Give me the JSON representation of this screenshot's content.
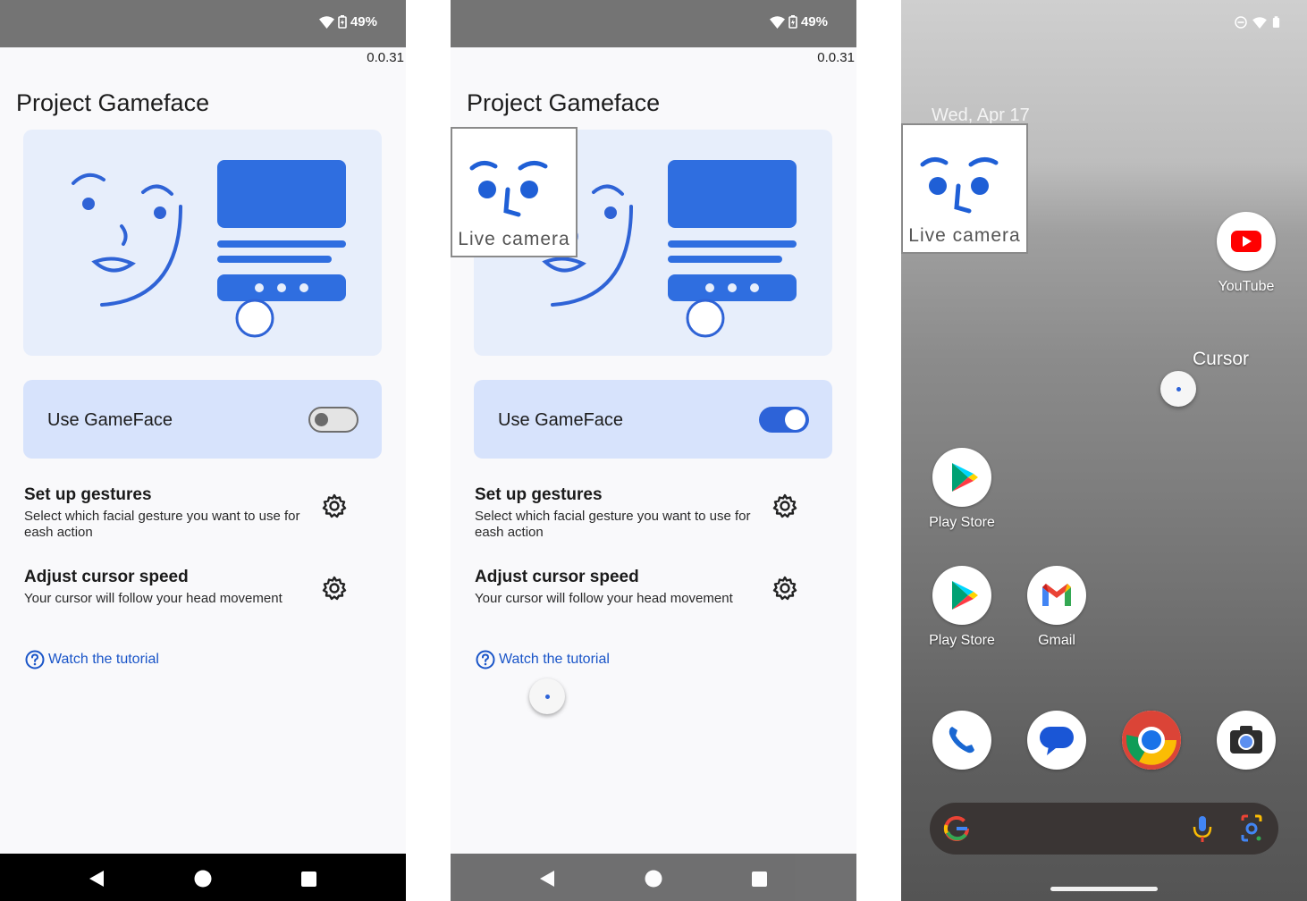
{
  "status": {
    "battery": "49%"
  },
  "app": {
    "version": "0.0.31",
    "title": "Project Gameface",
    "toggle_label": "Use GameFace",
    "settings": [
      {
        "title": "Set up gestures",
        "desc": "Select which facial gesture you want to use for eash action"
      },
      {
        "title": "Adjust cursor speed",
        "desc": "Your cursor will follow your head movement"
      }
    ],
    "tutorial": "Watch the tutorial",
    "live_camera": "Live camera"
  },
  "screens": [
    {
      "toggle_state": "off"
    },
    {
      "toggle_state": "on"
    },
    {
      "name": "home"
    }
  ],
  "home": {
    "date": "Wed, Apr 17",
    "cursor_label": "Cursor",
    "apps": [
      {
        "label": "YouTube",
        "icon": "youtube-icon"
      },
      {
        "label": "Play Store",
        "icon": "play-store-icon"
      },
      {
        "label": "Play Store",
        "icon": "play-store-icon"
      },
      {
        "label": "Gmail",
        "icon": "gmail-icon"
      }
    ],
    "dock": [
      "phone-icon",
      "messages-icon",
      "chrome-icon",
      "camera-icon"
    ]
  },
  "colors": {
    "accent": "#2d63d8",
    "link": "#1a55c8",
    "card": "#d7e3fc",
    "hero": "#e7eefb"
  }
}
